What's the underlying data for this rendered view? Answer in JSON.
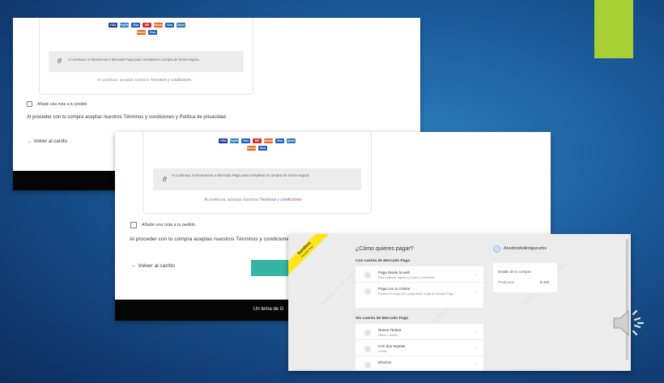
{
  "screenshot1": {
    "card_logos": [
      "VISA",
      "PayPal",
      "Visa",
      "MP",
      "Master",
      "Visa",
      "Amex",
      "Master",
      "Visa"
    ],
    "redirect_note": "Al continuar, te llevaremos a Mercado Pago para completar tu compra de forma segura.",
    "terms_prefix": "Al continuar, aceptas nuestros",
    "terms_link": "Términos y condiciones",
    "add_note_label": "Añade una nota a tu pedido",
    "legal_text": "Al proceder con tu compra aceptas nuestros Términos y condiciones y Política de privacidad",
    "back_link": "← Volver al carrito"
  },
  "screenshot2": {
    "card_logos": [
      "VISA",
      "PayPal",
      "Visa",
      "MP",
      "Master",
      "Visa",
      "Amex",
      "Master",
      "Visa"
    ],
    "redirect_note": "Al continuar, te llevaremos a Mercado Pago para completar tu compra de forma segura.",
    "terms_prefix": "Al continuar, aceptas nuestros",
    "terms_link": "Términos y condiciones",
    "add_note_label": "Añade una nota a tu pedido",
    "legal_text": "Al proceder con tu compra aceptas nuestros Términos y condicione",
    "back_link": "← Volver al carrito",
    "footer_text": "Un tema de G"
  },
  "mercadopago": {
    "sandbox_label": "Sandbox",
    "sandbox_sub": "Mercado Pago",
    "question": "¿Cómo quieres pagar?",
    "with_account_title": "Con cuenta de Mercado Pago",
    "with_account_rows": [
      {
        "title": "Paga desde la web",
        "subtitle": "Para continuar, ingresa tu e-mail y contraseña."
      },
      {
        "title": "Paga con tu celular",
        "subtitle": "Escanea el código QR y paga desde la app de Mercado Pago."
      }
    ],
    "without_account_title": "Sin cuenta de Mercado Pago",
    "without_account_rows": [
      {
        "title": "Nueva Tarjeta",
        "subtitle": "Débito o crédito"
      },
      {
        "title": "Con dos tarjetas",
        "subtitle": "Crédito"
      },
      {
        "title": "Efectivo",
        "subtitle": ""
      }
    ],
    "store_name": "AnudondoAmigurumis",
    "purchase_detail": "Detalle de tu compra",
    "products_label": "Productos",
    "products_value": "$ 498",
    "watermark": "Sandbox de Mercado Pago"
  },
  "colors": {
    "accent": "#a8cf33",
    "link": "#7b5ea8",
    "button": "#35b6a3",
    "sandbox": "#ffe41a"
  }
}
